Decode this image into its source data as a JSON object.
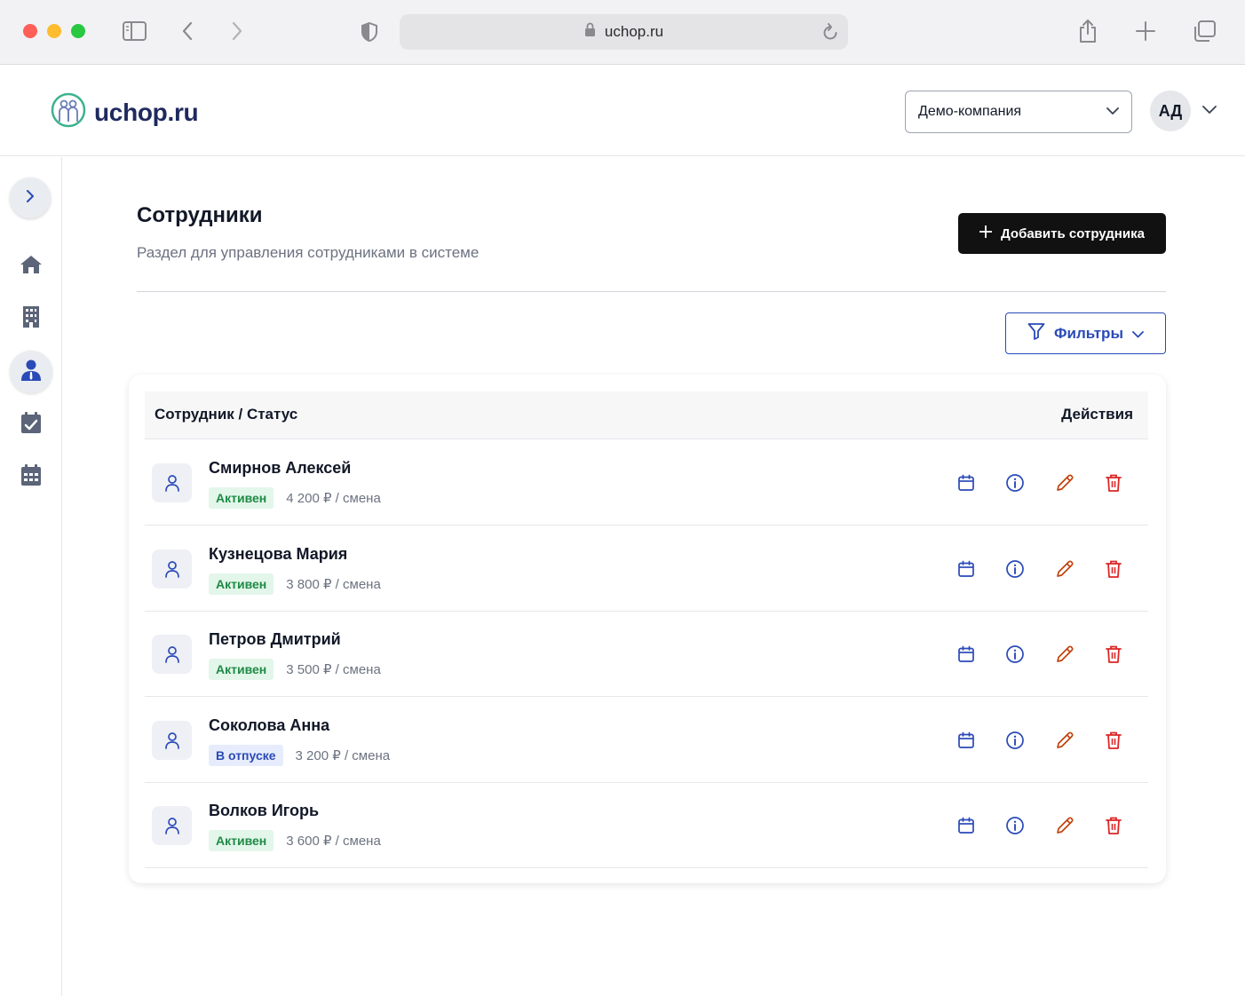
{
  "browser": {
    "url": "uchop.ru"
  },
  "header": {
    "logo_text": "uchop.ru",
    "company_select": "Демо-компания",
    "user_initials": "АД"
  },
  "sidebar": {
    "items": [
      {
        "icon": "home-icon"
      },
      {
        "icon": "building-icon"
      },
      {
        "icon": "employee-icon",
        "active": true
      },
      {
        "icon": "calendar-check-icon"
      },
      {
        "icon": "calendar-grid-icon"
      }
    ]
  },
  "main": {
    "title": "Сотрудники",
    "subtitle": "Раздел для управления сотрудниками в системе",
    "add_button": "Добавить сотрудника",
    "filters_button": "Фильтры"
  },
  "table": {
    "col_employee": "Сотрудник / Статус",
    "col_actions": "Действия",
    "rows": [
      {
        "name": "Смирнов Алексей",
        "status": "Активен",
        "status_type": "active",
        "rate": "4 200 ₽ / смена"
      },
      {
        "name": "Кузнецова Мария",
        "status": "Активен",
        "status_type": "active",
        "rate": "3 800 ₽ / смена"
      },
      {
        "name": "Петров Дмитрий",
        "status": "Активен",
        "status_type": "active",
        "rate": "3 500 ₽ / смена"
      },
      {
        "name": "Соколова Анна",
        "status": "В отпуске",
        "status_type": "vacation",
        "rate": "3 200 ₽ / смена"
      },
      {
        "name": "Волков Игорь",
        "status": "Активен",
        "status_type": "active",
        "rate": "3 600 ₽ / смена"
      }
    ]
  },
  "colors": {
    "primary_blue": "#2a4ab7",
    "danger_red": "#dc2626",
    "edit_red": "#c2410c",
    "active_green": "#1e8a45",
    "dark_button": "#111111"
  }
}
